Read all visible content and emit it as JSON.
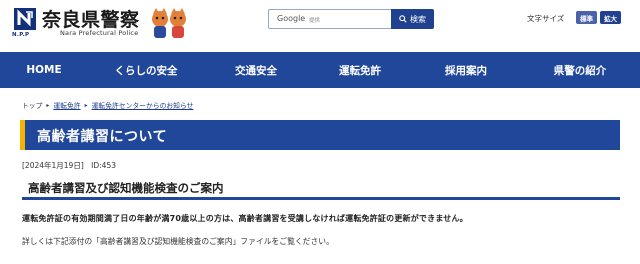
{
  "header": {
    "npp": "N.P.P",
    "title": "奈良県警察",
    "subtitle": "Nara Prefectural Police",
    "search": {
      "brand": "Google",
      "placeholder": "提供",
      "button_label": "検索"
    },
    "font_size": {
      "label": "文字サイズ",
      "normal": "標準",
      "large": "拡大"
    }
  },
  "nav": {
    "items": [
      "HOME",
      "くらしの安全",
      "交通安全",
      "運転免許",
      "採用案内",
      "県警の紹介"
    ]
  },
  "breadcrumb": {
    "items": [
      "トップ",
      "運転免許",
      "運転免許センターからのお知らせ"
    ]
  },
  "article": {
    "title": "高齢者講習について",
    "date": "[2024年1月19日]",
    "id": "ID:453",
    "section_heading": "高齢者講習及び認知機能検査のご案内",
    "lead": "運転免許証の有効期間満了日の年齢が満70歳以上の方は、高齢者講習を受講しなければ運転免許証の更新ができません。",
    "paragraph": "詳しくは下記添付の「高齢者講習及び認知機能検査のご案内」ファイルをご覧ください。"
  },
  "colors": {
    "primary": "#21479b",
    "accent": "#f4b400",
    "link": "#1d3b8c"
  }
}
